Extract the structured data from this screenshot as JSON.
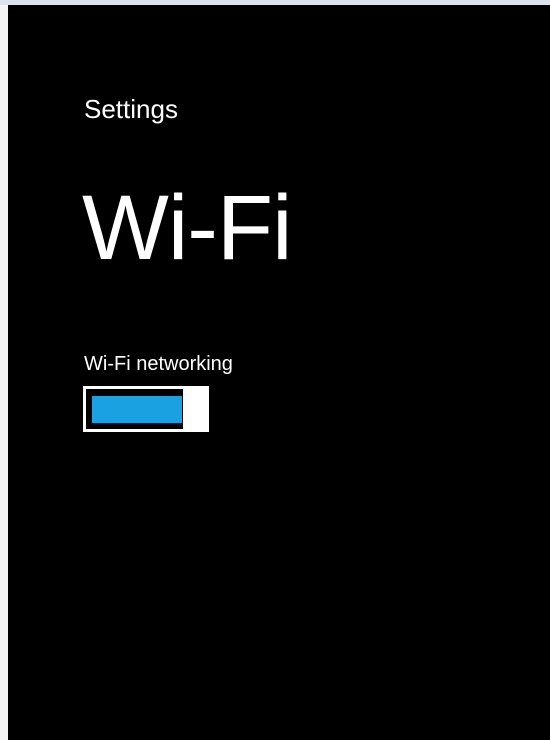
{
  "window": {
    "header": "Settings",
    "title": "Wi-Fi"
  },
  "wifi_networking": {
    "label": "Wi-Fi networking",
    "state": "on",
    "accent_color": "#1aa1e1"
  }
}
